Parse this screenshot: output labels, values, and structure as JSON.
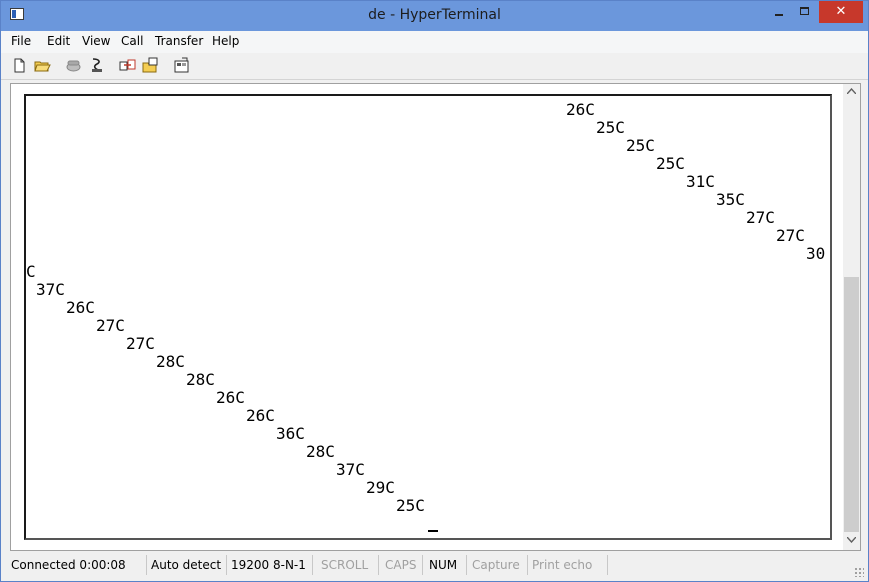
{
  "window": {
    "title": "de - HyperTerminal",
    "close_glyph": "✕"
  },
  "menu": [
    "File",
    "Edit",
    "View",
    "Call",
    "Transfer",
    "Help"
  ],
  "toolbar": {
    "icons": [
      "new-icon",
      "open-icon",
      "disconnect-icon",
      "dial-icon",
      "send-icon",
      "receive-icon",
      "properties-icon"
    ]
  },
  "terminal": {
    "lines": [
      {
        "text": "26C"
      },
      {
        "text": "25C"
      },
      {
        "text": "25C"
      },
      {
        "text": "25C"
      },
      {
        "text": "31C"
      },
      {
        "text": "35C"
      },
      {
        "text": "27C"
      },
      {
        "text": "27C"
      },
      {
        "text": "30"
      },
      {
        "text": "C"
      },
      {
        "text": "37C"
      },
      {
        "text": "26C"
      },
      {
        "text": "27C"
      },
      {
        "text": "27C"
      },
      {
        "text": "28C"
      },
      {
        "text": "28C"
      },
      {
        "text": "26C"
      },
      {
        "text": "26C"
      },
      {
        "text": "36C"
      },
      {
        "text": "28C"
      },
      {
        "text": "37C"
      },
      {
        "text": "29C"
      },
      {
        "text": "25C"
      }
    ]
  },
  "statusbar": {
    "connected": "Connected 0:00:08",
    "detect": "Auto detect",
    "settings": "19200 8-N-1",
    "scroll": "SCROLL",
    "caps": "CAPS",
    "num": "NUM",
    "capture": "Capture",
    "print_echo": "Print echo"
  }
}
